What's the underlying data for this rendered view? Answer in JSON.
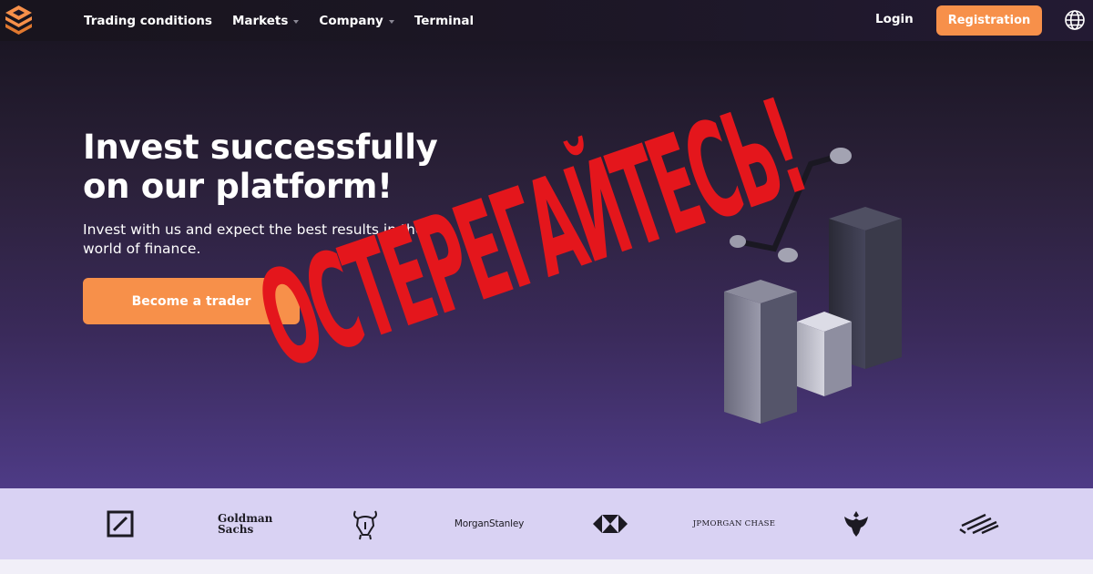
{
  "nav": {
    "links": [
      {
        "label": "Trading conditions",
        "dropdown": false
      },
      {
        "label": "Markets",
        "dropdown": true
      },
      {
        "label": "Company",
        "dropdown": true
      },
      {
        "label": "Terminal",
        "dropdown": false
      }
    ],
    "login_label": "Login",
    "register_label": "Registration",
    "language_icon": "globe-icon"
  },
  "hero": {
    "title_line1": "Invest successfully",
    "title_line2": "on our platform!",
    "subtitle_line1": "Invest with us and expect the best results in the",
    "subtitle_line2": "world of finance.",
    "cta_label": "Become a trader"
  },
  "warning_overlay": {
    "text": "ОСТЕРЕГАЙТЕСЬ!",
    "color": "#e4161c"
  },
  "partners": {
    "logos": [
      {
        "name": "deutsche-bank-logo"
      },
      {
        "name": "goldman-sachs-logo",
        "text_line1": "Goldman",
        "text_line2": "Sachs"
      },
      {
        "name": "merrill-bull-logo"
      },
      {
        "name": "morgan-stanley-logo",
        "text": "MorganStanley"
      },
      {
        "name": "hsbc-logo"
      },
      {
        "name": "jpmorgan-chase-logo",
        "text": "JPMORGAN CHASE"
      },
      {
        "name": "barclays-eagle-logo"
      },
      {
        "name": "bank-of-america-logo"
      }
    ]
  },
  "colors": {
    "accent": "#f7904a",
    "nav_bg": "#1d1727",
    "hero_bottom": "#4e3b86",
    "partners_bg": "#d9d2f3"
  }
}
